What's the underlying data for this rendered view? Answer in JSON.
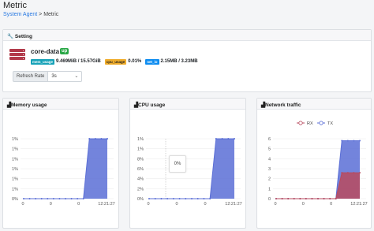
{
  "header": {
    "title": "Metric",
    "breadcrumb_link": "System Agent",
    "breadcrumb_sep": " > ",
    "breadcrumb_current": "Metric"
  },
  "setting": {
    "title": "Setting",
    "icon": "wrench-icon",
    "server_icon": "server-icon",
    "server_name": "core-data",
    "status": "up",
    "status_color": "#28a745",
    "mem_tag": "mem_usage",
    "mem_value": "9.469MiB / 15.57GiB",
    "cpu_tag": "cpu_usage",
    "cpu_value": "0.01%",
    "net_tag": "net_io",
    "net_value": "2.15MB / 3.23MB",
    "refresh_label": "Refresh Rate",
    "refresh_value": "3s"
  },
  "memory_card": {
    "title": "Memory usage",
    "icon": "chart-icon"
  },
  "cpu_card": {
    "title": "CPU usage",
    "icon": "chart-icon",
    "tooltip": "0%"
  },
  "network_card": {
    "title": "Network traffic",
    "icon": "chart-icon"
  },
  "chart_data": [
    {
      "type": "area",
      "title": "Memory usage",
      "ytick_labels": [
        "0%",
        "1%",
        "1%",
        "1%",
        "1%",
        "1%",
        "1%"
      ],
      "ylim": [
        0,
        6
      ],
      "xtick_labels": [
        "0",
        "0",
        "0",
        "12:21:27"
      ],
      "series": [
        {
          "color": "#5b6fd6",
          "values": [
            0,
            0,
            0,
            0,
            0,
            0,
            0,
            0,
            0,
            0,
            0,
            6,
            6,
            6,
            6
          ]
        }
      ]
    },
    {
      "type": "area",
      "title": "CPU usage",
      "ytick_labels": [
        "0%",
        "2%",
        "4%",
        "6%",
        "8%",
        "1%",
        "1%"
      ],
      "ylim": [
        0,
        6
      ],
      "xtick_labels": [
        "0",
        "0",
        "0",
        "12:21:27"
      ],
      "series": [
        {
          "color": "#5b6fd6",
          "values": [
            0,
            0,
            0,
            0,
            0,
            0,
            0,
            0,
            0,
            0,
            0,
            6,
            6,
            6,
            6
          ]
        }
      ]
    },
    {
      "type": "area",
      "title": "Network traffic",
      "ytick_labels": [
        "0",
        "1",
        "2",
        "3",
        "4",
        "5",
        "6"
      ],
      "ylim": [
        0,
        6
      ],
      "xtick_labels": [
        "0",
        "0",
        "0",
        "12:21:27"
      ],
      "series": [
        {
          "name": "TX",
          "color": "#5b6fd6",
          "values": [
            0,
            0,
            0,
            0,
            0,
            0,
            0,
            0,
            0,
            0,
            0,
            5.8,
            5.8,
            5.8,
            5.8
          ]
        },
        {
          "name": "RX",
          "color": "#b84a5e",
          "values": [
            0,
            0,
            0,
            0,
            0,
            0,
            0,
            0,
            0,
            0,
            0,
            2.6,
            2.6,
            2.6,
            2.6
          ]
        }
      ],
      "legend": [
        "RX",
        "TX"
      ],
      "legend_colors": [
        "#b84a5e",
        "#5b6fd6"
      ],
      "legend_position": "top-right"
    }
  ]
}
